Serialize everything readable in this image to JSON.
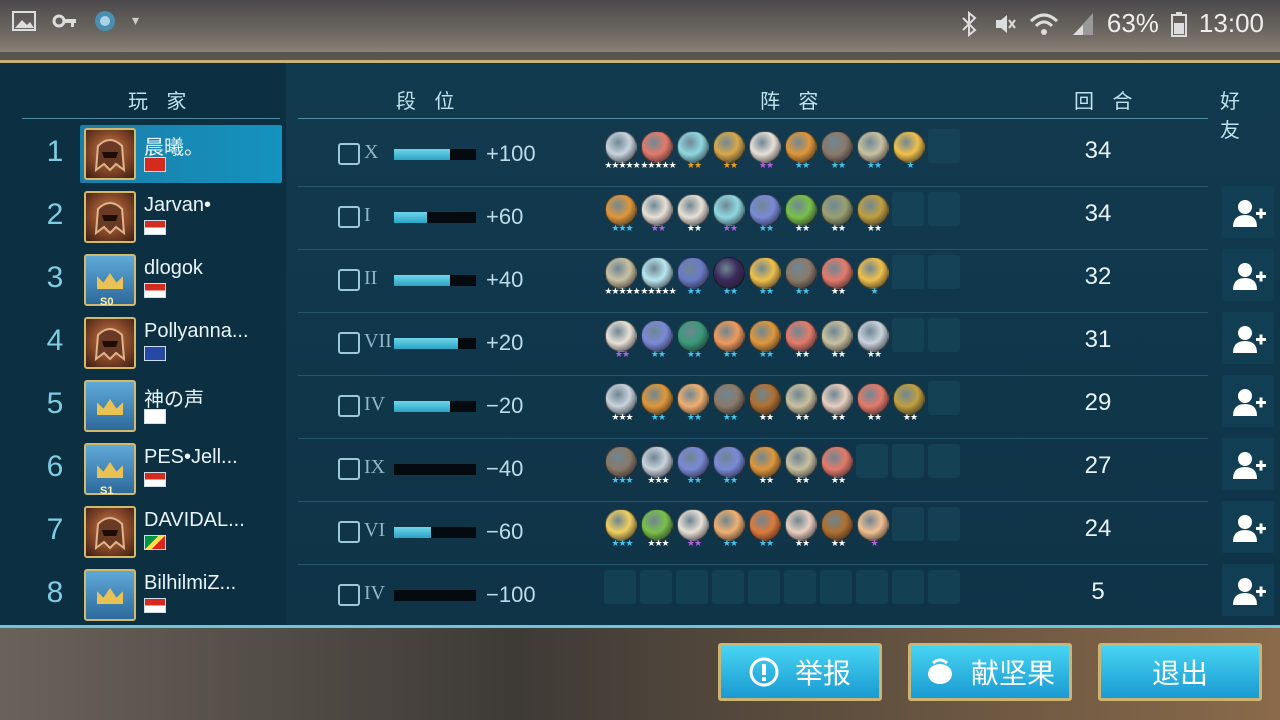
{
  "status_bar": {
    "battery": "63%",
    "time": "13:00"
  },
  "headers": {
    "player": "玩 家",
    "rank": "段 位",
    "lineup": "阵 容",
    "round": "回 合",
    "friend": "好 友"
  },
  "rows": [
    {
      "rank": "1",
      "name": "晨曦。",
      "tier_icon": "tower-icon",
      "tier": "X",
      "bar": 0.68,
      "delta": "+100",
      "round": "34",
      "avatar": "fire",
      "flag": "cn",
      "season": "",
      "self": true,
      "lineup": [
        [
          "#c9d3dd",
          "5w"
        ],
        [
          "#e47b6b",
          "5w"
        ],
        [
          "#8fd8e0",
          "2o"
        ],
        [
          "#d8a84a",
          "2o"
        ],
        [
          "#e8e1d6",
          "2p"
        ],
        [
          "#e0973a",
          "2b"
        ],
        [
          "#8a7a6a",
          "2b"
        ],
        [
          "#c9c1a0",
          "2b"
        ],
        [
          "#f0c04a",
          "1b"
        ]
      ],
      "empty": 1
    },
    {
      "rank": "2",
      "name": "Jarvan•",
      "tier_icon": "anchor-icon",
      "tier": "I",
      "bar": 0.4,
      "delta": "+60",
      "round": "34",
      "avatar": "fire",
      "flag": "id",
      "season": "",
      "self": false,
      "lineup": [
        [
          "#e0973a",
          "3b"
        ],
        [
          "#e8e1d6",
          "2p"
        ],
        [
          "#e8e1d6",
          "2w"
        ],
        [
          "#8fd8e0",
          "2p"
        ],
        [
          "#7a8ad8",
          "2b"
        ],
        [
          "#7ac04a",
          "2w"
        ],
        [
          "#9aa070",
          "2w"
        ],
        [
          "#c0a040",
          "2w"
        ]
      ],
      "empty": 2
    },
    {
      "rank": "3",
      "name": "dlogok",
      "tier_icon": "tower-icon",
      "tier": "II",
      "bar": 0.68,
      "delta": "+40",
      "round": "32",
      "avatar": "crown",
      "flag": "id",
      "season": "S0",
      "self": false,
      "lineup": [
        [
          "#c9c1a0",
          "5w"
        ],
        [
          "#b8e6ef",
          "5w"
        ],
        [
          "#6a7ac8",
          "2b"
        ],
        [
          "#3a2a5a",
          "2b"
        ],
        [
          "#f0c04a",
          "2b"
        ],
        [
          "#8a7a6a",
          "2b"
        ],
        [
          "#e47b6b",
          "2w"
        ],
        [
          "#f0c04a",
          "1b"
        ]
      ],
      "empty": 2
    },
    {
      "rank": "4",
      "name": "Pollyanna...",
      "tier_icon": "tower-icon",
      "tier": "VII",
      "bar": 0.78,
      "delta": "+20",
      "round": "31",
      "avatar": "fire",
      "flag": "xk",
      "season": "",
      "self": false,
      "lineup": [
        [
          "#e8e1d6",
          "2p"
        ],
        [
          "#7a8ad8",
          "2b"
        ],
        [
          "#3a9a7a",
          "2b"
        ],
        [
          "#f09a5a",
          "2b"
        ],
        [
          "#e0973a",
          "2b"
        ],
        [
          "#e47b6b",
          "2w"
        ],
        [
          "#c9c1a0",
          "2w"
        ],
        [
          "#c9d3dd",
          "2w"
        ]
      ],
      "empty": 2
    },
    {
      "rank": "5",
      "name": "神の声",
      "tier_icon": "tower-icon",
      "tier": "IV",
      "bar": 0.68,
      "delta": "−20",
      "round": "29",
      "avatar": "crown",
      "flag": "kr",
      "season": "",
      "self": false,
      "lineup": [
        [
          "#c9d3dd",
          "3w"
        ],
        [
          "#e0973a",
          "2b"
        ],
        [
          "#f0b070",
          "2b"
        ],
        [
          "#8a7a6a",
          "2b"
        ],
        [
          "#b07030",
          "2w"
        ],
        [
          "#c9c1a0",
          "2w"
        ],
        [
          "#e8d0c0",
          "2w"
        ],
        [
          "#e47b6b",
          "2w"
        ],
        [
          "#c0a040",
          "2w"
        ]
      ],
      "empty": 1
    },
    {
      "rank": "6",
      "name": "PES•Jell...",
      "tier_icon": "tower-icon",
      "tier": "IX",
      "bar": 0.0,
      "delta": "−40",
      "round": "27",
      "avatar": "crown",
      "flag": "id",
      "season": "S1",
      "self": false,
      "lineup": [
        [
          "#8a7a6a",
          "3b"
        ],
        [
          "#c9d3dd",
          "3w"
        ],
        [
          "#7a8ad8",
          "2b"
        ],
        [
          "#7a8ad8",
          "2b"
        ],
        [
          "#e0973a",
          "2w"
        ],
        [
          "#c9c1a0",
          "2w"
        ],
        [
          "#e47b6b",
          "2w"
        ]
      ],
      "empty": 3
    },
    {
      "rank": "7",
      "name": "DAVIDAL...",
      "tier_icon": "tower-icon",
      "tier": "VI",
      "bar": 0.45,
      "delta": "−60",
      "round": "24",
      "avatar": "fire",
      "flag": "cg",
      "season": "",
      "self": false,
      "lineup": [
        [
          "#f0d060",
          "3b"
        ],
        [
          "#7ac04a",
          "3w"
        ],
        [
          "#e8e1d6",
          "2p"
        ],
        [
          "#f0b070",
          "2b"
        ],
        [
          "#e07a3a",
          "2b"
        ],
        [
          "#e8d0c0",
          "2w"
        ],
        [
          "#b07030",
          "2w"
        ],
        [
          "#f0c090",
          "1p"
        ]
      ],
      "empty": 2
    },
    {
      "rank": "8",
      "name": "BilhilmiZ...",
      "tier_icon": "tower-icon",
      "tier": "IV",
      "bar": 0.0,
      "delta": "−100",
      "round": "5",
      "avatar": "crown",
      "flag": "id",
      "season": "",
      "self": false,
      "lineup": [],
      "empty": 10
    }
  ],
  "buttons": {
    "report": "举报",
    "gift": "献坚果",
    "exit": "退出"
  },
  "colors": {
    "accent": "#1b9ad2",
    "gold": "#cdb473",
    "panel": "#123a4f"
  }
}
